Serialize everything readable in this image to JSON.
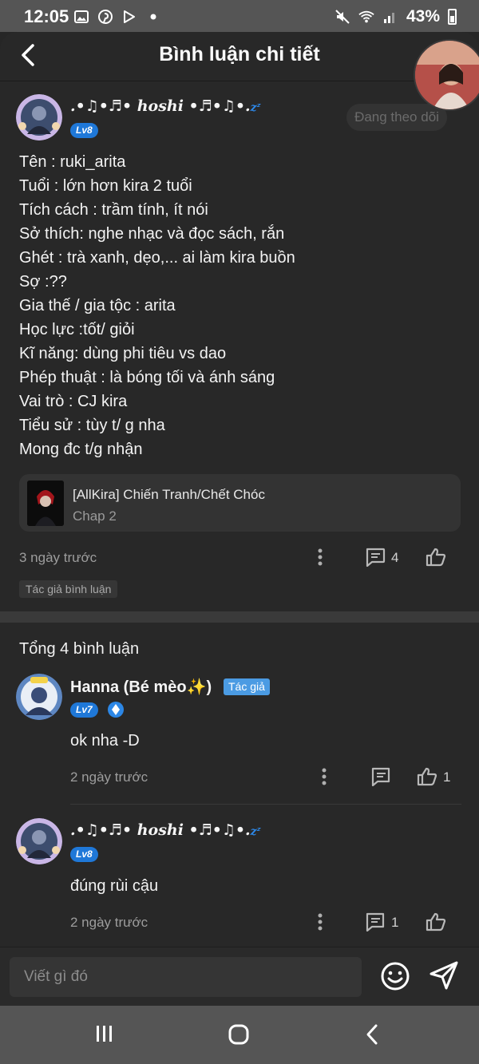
{
  "status_bar": {
    "time": "12:05",
    "battery": "43%"
  },
  "header": {
    "title": "Bình luận chi tiết"
  },
  "main_comment": {
    "username": ".•♫•♬• 𝒉𝒐𝒔𝒉𝒊 •♬•♫•.",
    "username_suffix": "zᶻ",
    "level": "Lv8",
    "follow_label": "Đang theo dõi",
    "lines": [
      "Tên : ruki_arita",
      "Tuổi : lớn hơn kira 2 tuổi",
      "Tích cách : trầm tính, ít nói",
      "Sở thích: nghe nhạc và đọc sách, rắn",
      "Ghét : trà xanh, dẹo,... ai làm kira buồn",
      "Sợ :??",
      "Gia thế / gia tộc : arita",
      "Học lực :tốt/ giỏi",
      "Kĩ năng: dùng phi tiêu vs dao",
      "Phép thuật : là bóng tối và ánh sáng",
      "Vai trò : CJ kira",
      "Tiểu sử : tùy t/ g nha",
      "Mong đc t/g nhận"
    ],
    "story": {
      "title": "[AllKira] Chiến Tranh/Chết Chóc",
      "chapter": "Chap 2"
    },
    "time_ago": "3 ngày trước",
    "reply_count": "4",
    "author_tag": "Tác giả bình luận"
  },
  "replies_section": {
    "total_label": "Tổng 4 bình luận",
    "replies": [
      {
        "username": "Hanna (Bé mèo✨)",
        "badge": "Tác giả",
        "level": "Lv7",
        "text": "ok nha -D",
        "time_ago": "2 ngày trước",
        "like_count": "1"
      },
      {
        "username": ".•♫•♬• 𝒉𝒐𝒔𝒉𝒊 •♬•♫•.",
        "username_suffix": "zᶻ",
        "level": "Lv8",
        "text": "đúng rùi cậu",
        "time_ago": "2 ngày trước",
        "reply_count": "1"
      }
    ]
  },
  "composer": {
    "placeholder": "Viết gì đó"
  },
  "colors": {
    "background": "#282828",
    "accent_blue": "#1f78d8",
    "author_badge": "#4b9be3"
  },
  "icons": [
    "back-icon",
    "more-icon",
    "comment-icon",
    "like-icon",
    "emoji-icon",
    "send-icon",
    "recents-icon",
    "home-icon",
    "nav-back-icon"
  ]
}
